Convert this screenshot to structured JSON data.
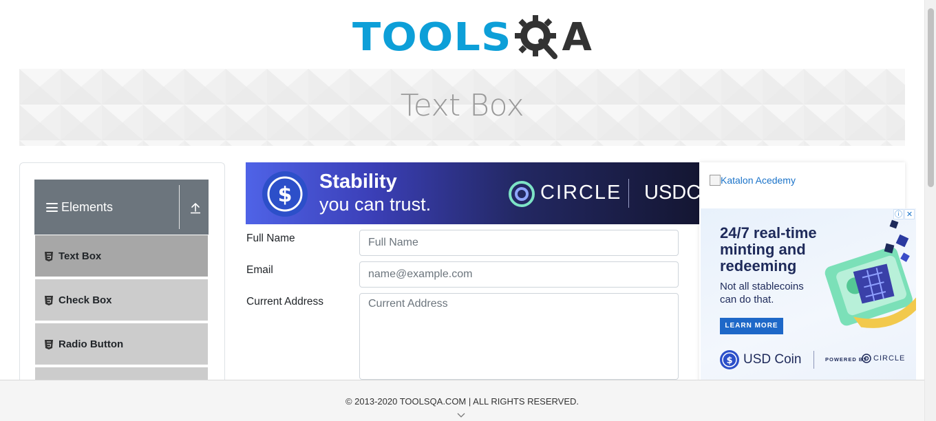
{
  "logo": {
    "part1": "TOOLS",
    "part2": "A",
    "icon": "gear-magnifier-icon"
  },
  "page": {
    "title": "Text Box"
  },
  "sidebar": {
    "group": {
      "title": "Elements",
      "menu_icon": "hamburger-icon",
      "collapse_icon": "upload-arrow-icon"
    },
    "items": [
      {
        "label": "Text Box",
        "icon": "html5-icon",
        "active": true
      },
      {
        "label": "Check Box",
        "icon": "html5-icon",
        "active": false
      },
      {
        "label": "Radio Button",
        "icon": "html5-icon",
        "active": false
      }
    ]
  },
  "ad_top": {
    "headline": "Stability",
    "subline": "you can trust.",
    "brand": "CIRCLE",
    "product": "USDC"
  },
  "form": {
    "full_name": {
      "label": "Full Name",
      "placeholder": "Full Name",
      "value": ""
    },
    "email": {
      "label": "Email",
      "placeholder": "name@example.com",
      "value": ""
    },
    "current_address": {
      "label": "Current Address",
      "placeholder": "Current Address",
      "value": ""
    }
  },
  "ad_right": {
    "katalon_alt": "Katalon Acedemy",
    "headline": "24/7 real-time minting and redeeming",
    "sub": "Not all stablecoins can do that.",
    "cta": "LEARN MORE",
    "coin_name": "USD Coin",
    "powered_by": "POWERED BY",
    "brand": "CIRCLE"
  },
  "footer": {
    "copyright": "© 2013-2020 TOOLSQA.COM | ALL RIGHTS RESERVED."
  },
  "colors": {
    "logo_blue": "#0d9fd8",
    "sidebar_header": "#6c757d",
    "menu_item": "#cccccc",
    "menu_item_active": "#a7a7a7",
    "page_title": "#999999"
  }
}
